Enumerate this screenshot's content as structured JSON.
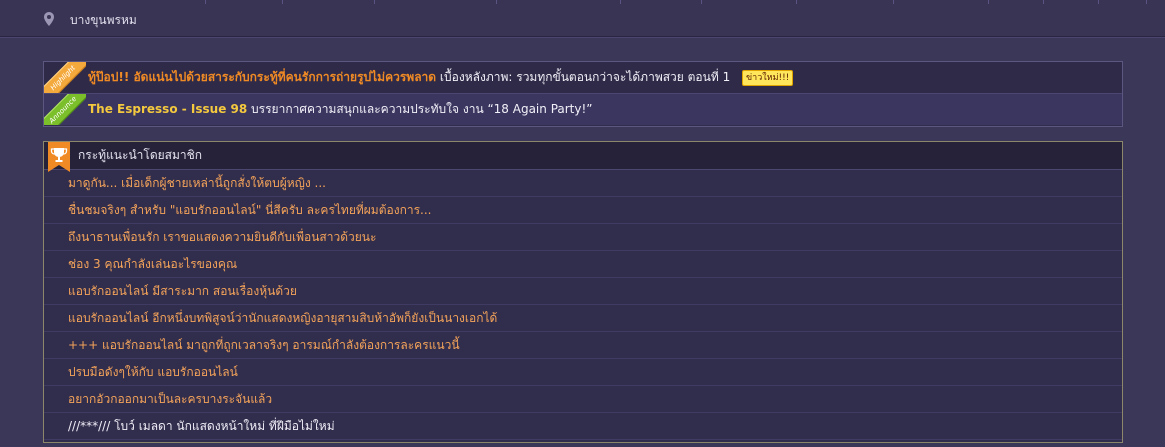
{
  "location": {
    "icon": "map-pin-icon",
    "text": "บางขุนพรหม"
  },
  "announcements": [
    {
      "ribbon_label": "Highlight",
      "ribbon_color": "#f4a93c",
      "headline": "ทู้ป๊อป!! อัดแน่นไปด้วยสาระกับกระทู้ที่คนรักการถ่ายรูปไม่ควรพลาด",
      "headline_color": "#f08a24",
      "detail": "เบื้องหลังภาพ: รวมทุกขั้นตอนกว่าจะได้ภาพสวย ตอนที่ 1",
      "badge": "ข่าวใหม่!!!"
    },
    {
      "ribbon_label": "Announce",
      "ribbon_color": "#7bbf2b",
      "headline": "The Espresso",
      "separator": " - ",
      "issue": "Issue 98",
      "headline_color": "#f4c93e",
      "detail": "บรรยากาศความสนุกและความประทับใจ งาน “18 Again Party!”"
    }
  ],
  "recommended": {
    "icon": "trophy-icon",
    "title": "กระทู้แนะนำโดยสมาชิก",
    "link_color": "#f5a45a",
    "topics": [
      "มาดูกัน... เมื่อเด็กผู้ชายเหล่านี้ถูกสั่งให้ตบผู้หญิง ...",
      "ชื่นชมจริงๆ สำหรับ \"แอบรักออนไลน์\" นี่สีครับ ละครไทยที่ผมต้องการ...",
      "ถึงนาธานเพื่อนรัก เราขอแสดงความยินดีกับเพื่อนสาวด้วยนะ",
      "ช่อง 3 คุณกำลังเล่นอะไรของคุณ",
      "แอบรักออนไลน์ มีสาระมาก สอนเรื่องหุ้นด้วย",
      "แอบรักออนไลน์ อีกหนึ่งบทพิสูจน์ว่านักแสดงหญิงอายุสามสิบห้าอัพก็ยังเป็นนางเอกได้",
      "+++ แอบรักออนไลน์ มาถูกที่ถูกเวลาจริงๆ อารมณ์กำลังต้องการละครแนวนี้",
      "ปรบมือดังๆให้กับ แอบรักออนไลน์",
      "อยากอัวกออกมาเป็นละครบางระจันแล้ว",
      "///***/// โบว์ เมลดา นักแสดงหน้าใหม่ ที่ฝีมือไม่ใหม่"
    ]
  }
}
